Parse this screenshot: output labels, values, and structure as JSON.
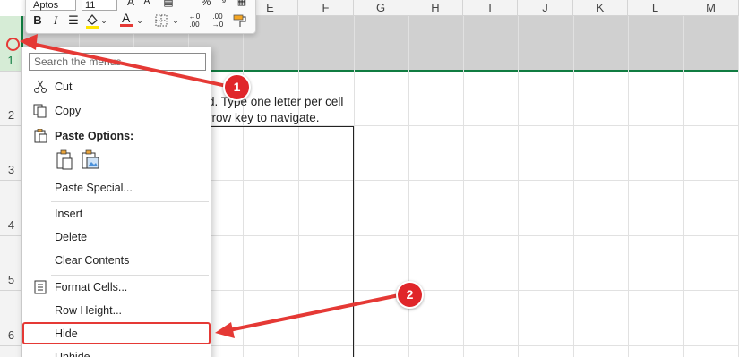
{
  "spreadsheet": {
    "columns": [
      "E",
      "F",
      "G",
      "H",
      "I",
      "J",
      "K",
      "L",
      "M"
    ],
    "rows": [
      "1",
      "2",
      "3",
      "4",
      "5",
      "6"
    ],
    "cell_text": {
      "line1": "d. Type one letter per cell",
      "line2": "rrow key to navigate."
    }
  },
  "mini_toolbar": {
    "font_name": "Aptos",
    "font_size": "11",
    "bold": "B",
    "italic": "I",
    "font_color": "A",
    "increase_decimal": "←0 .00",
    "decrease_decimal": ".00 →0"
  },
  "context_menu": {
    "search_placeholder": "Search the menus",
    "items": {
      "cut": "Cut",
      "copy": "Copy",
      "paste_options": "Paste Options:",
      "paste_special": "Paste Special...",
      "insert": "Insert",
      "delete": "Delete",
      "clear_contents": "Clear Contents",
      "format_cells": "Format Cells...",
      "row_height": "Row Height...",
      "hide": "Hide",
      "unhide": "Unhide"
    }
  },
  "annotations": {
    "badge1": "1",
    "badge2": "2",
    "color": "#e0262a"
  },
  "colors": {
    "accent": "#107c41",
    "selected_row_band": "#d0d0d0"
  }
}
